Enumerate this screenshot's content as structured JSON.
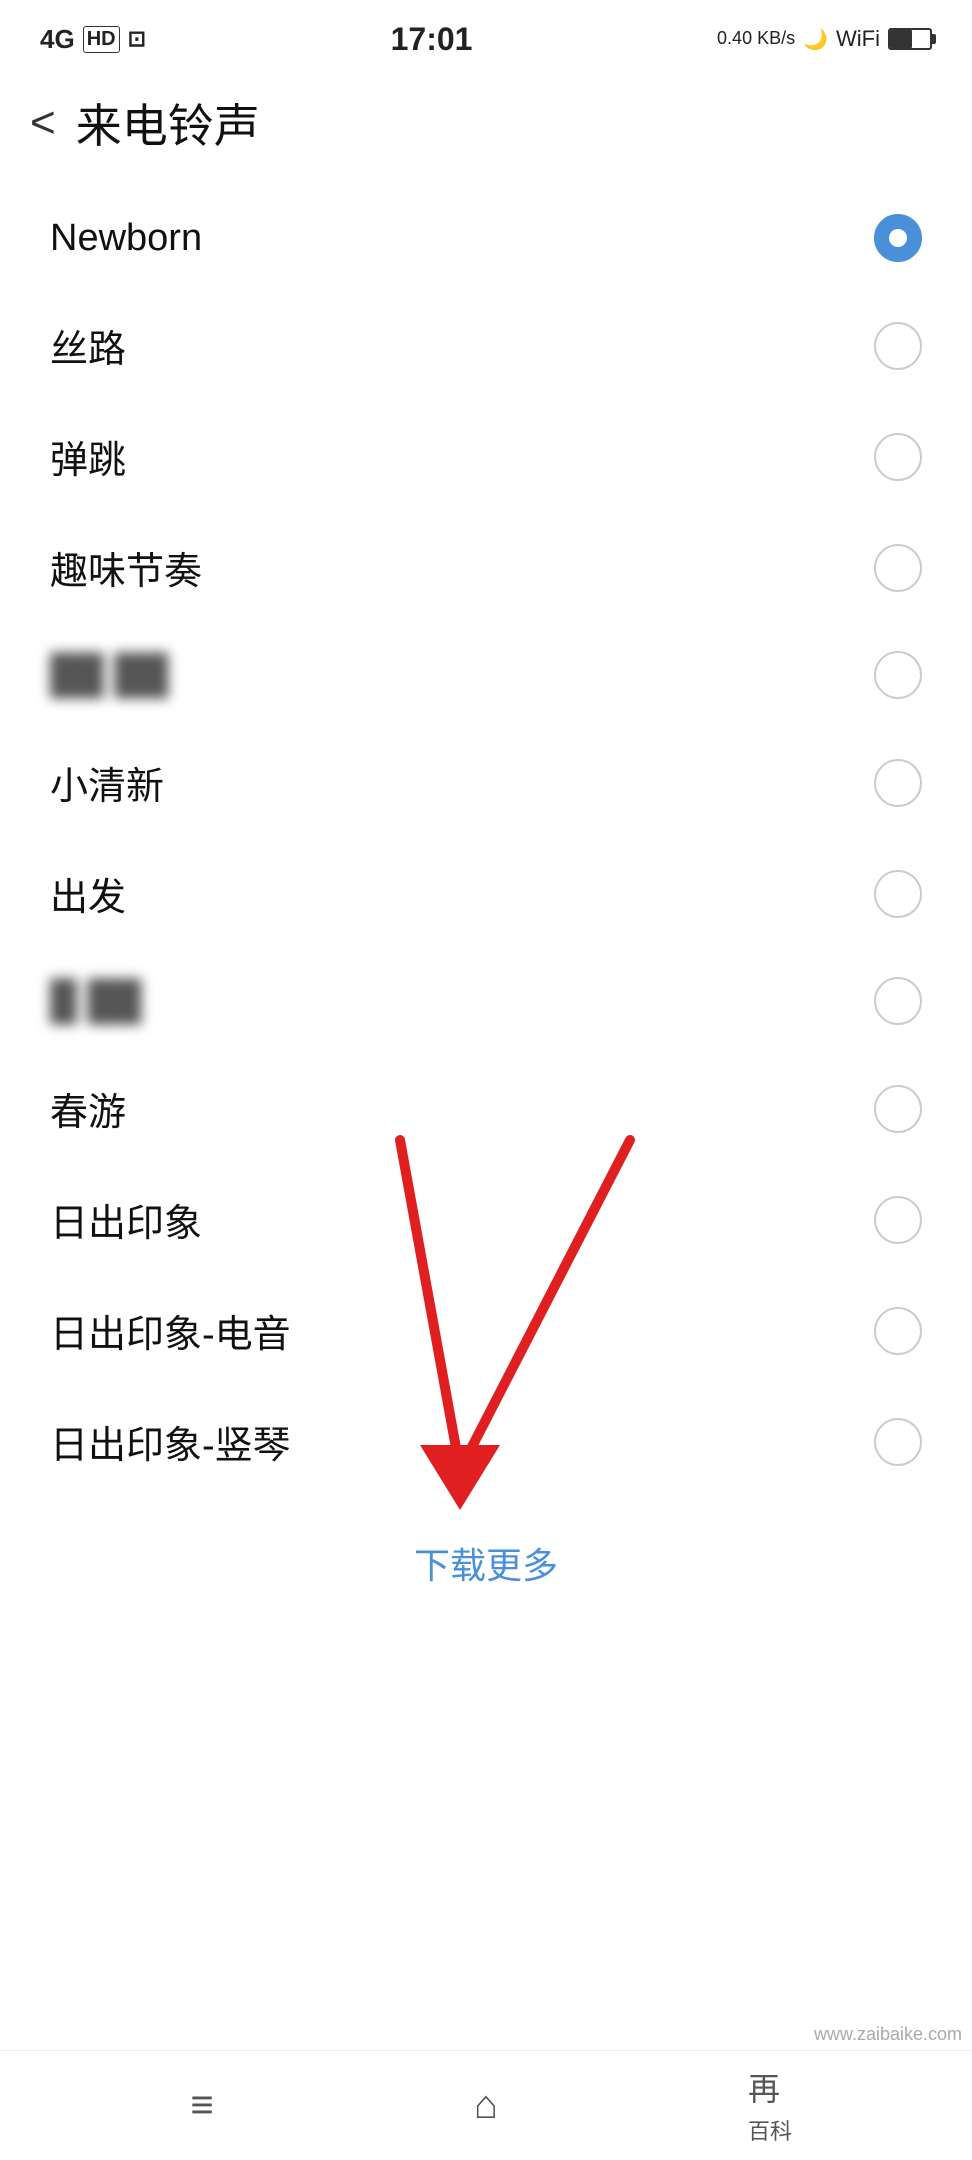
{
  "statusBar": {
    "time": "17:01",
    "leftIcons": "4G HD",
    "rightData": "0.40 KB/s"
  },
  "header": {
    "backLabel": "<",
    "title": "来电铃声"
  },
  "ringtones": [
    {
      "id": 1,
      "name": "Newborn",
      "selected": true,
      "blurred": false
    },
    {
      "id": 2,
      "name": "丝路",
      "selected": false,
      "blurred": false
    },
    {
      "id": 3,
      "name": "弹跳",
      "selected": false,
      "blurred": false
    },
    {
      "id": 4,
      "name": "趣味节奏",
      "selected": false,
      "blurred": false
    },
    {
      "id": 5,
      "name": "██ ██",
      "selected": false,
      "blurred": true
    },
    {
      "id": 6,
      "name": "小清新",
      "selected": false,
      "blurred": false
    },
    {
      "id": 7,
      "name": "出发",
      "selected": false,
      "blurred": false
    },
    {
      "id": 8,
      "name": "█ ██",
      "selected": false,
      "blurred": true
    },
    {
      "id": 9,
      "name": "春游",
      "selected": false,
      "blurred": false
    },
    {
      "id": 10,
      "name": "日出印象",
      "selected": false,
      "blurred": false
    },
    {
      "id": 11,
      "name": "日出印象-电音",
      "selected": false,
      "blurred": false
    },
    {
      "id": 12,
      "name": "日出印象-竖琴",
      "selected": false,
      "blurred": false
    }
  ],
  "downloadMore": {
    "label": "下载更多"
  },
  "bottomNav": {
    "menu": "≡",
    "home": "⌂",
    "wiki": "百科"
  },
  "watermark": "www.zaibaike.com"
}
